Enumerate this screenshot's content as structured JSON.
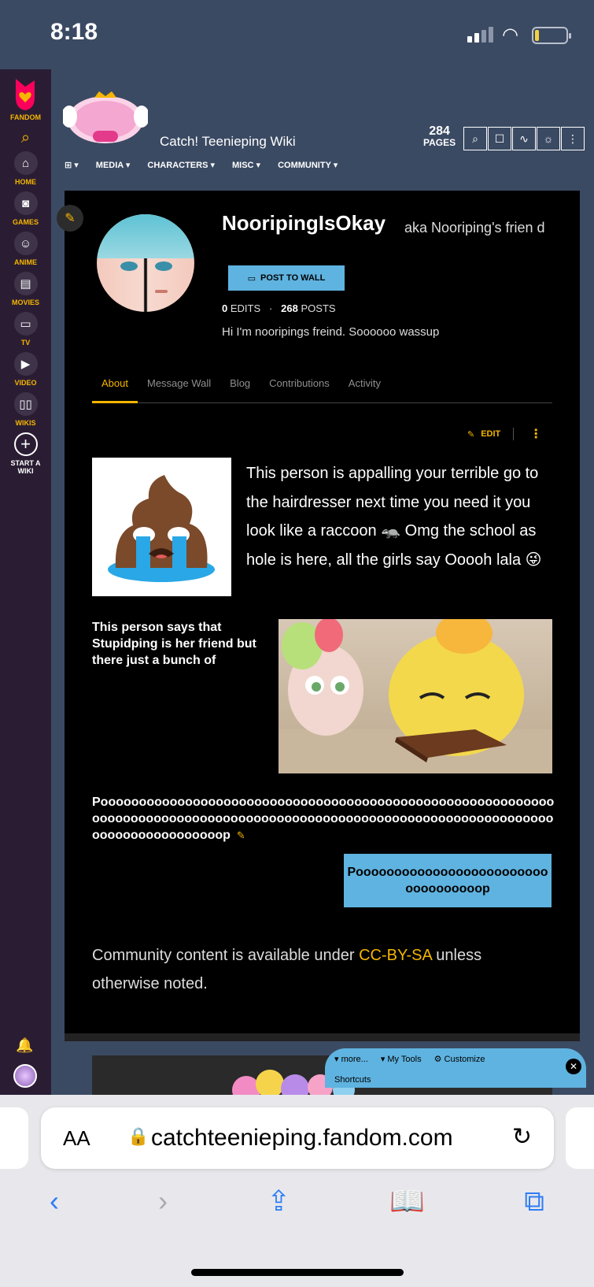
{
  "status": {
    "time": "8:18"
  },
  "rail": {
    "fandom_label": "FANDOM",
    "items": [
      {
        "label": "HOME",
        "icon": "home-icon"
      },
      {
        "label": "GAMES",
        "icon": "gamepad-icon"
      },
      {
        "label": "ANIME",
        "icon": "anime-icon"
      },
      {
        "label": "MOVIES",
        "icon": "film-icon"
      },
      {
        "label": "TV",
        "icon": "tv-icon"
      },
      {
        "label": "VIDEO",
        "icon": "play-icon"
      },
      {
        "label": "WIKIS",
        "icon": "book-icon"
      },
      {
        "label": "START A\nWIKI",
        "icon": "plus-icon"
      }
    ]
  },
  "wiki": {
    "name": "Catch! Teenieping Wiki",
    "pages_count": "284",
    "pages_label": "PAGES",
    "nav": [
      "MEDIA",
      "CHARACTERS",
      "MISC",
      "COMMUNITY"
    ]
  },
  "profile": {
    "username": "NooripingIsOkay",
    "aka": "aka Nooriping's frien d",
    "post_button": "POST TO WALL",
    "edits_count": "0",
    "edits_label": "EDITS",
    "posts_count": "268",
    "posts_label": "POSTS",
    "bio": "Hi I'm nooripings freind. Soooooo wassup",
    "tabs": [
      "About",
      "Message Wall",
      "Blog",
      "Contributions",
      "Activity"
    ],
    "edit_label": "EDIT"
  },
  "content": {
    "paragraph1": "This person is appalling your terrible go to the hairdresser next time you need it you look like a raccoon 🦡 Omg the school as hole is here, all the girls say Ooooh lala 😜",
    "paragraph2": "This person says that Stupidping is her friend but there just a bunch of",
    "paragraph3": "Poooooooooooooooooooooooooooooooooooooooooooooooooooooooooooooooooooooooooooooooooooooooooooooooooooooooooooooooooooooooooooooooooooooooop",
    "blue_box": "Pooooooooooooooooooooooooooooooooooop",
    "license_prefix": "Community content is available under ",
    "license_link": "CC-BY-SA",
    "license_suffix": " unless otherwise noted."
  },
  "toolbar": {
    "more": "more...",
    "my_tools": "My Tools",
    "customize": "Customize",
    "shortcuts": "Shortcuts"
  },
  "browser": {
    "aa": "AA",
    "url": "catchteenieping.fandom.com"
  }
}
